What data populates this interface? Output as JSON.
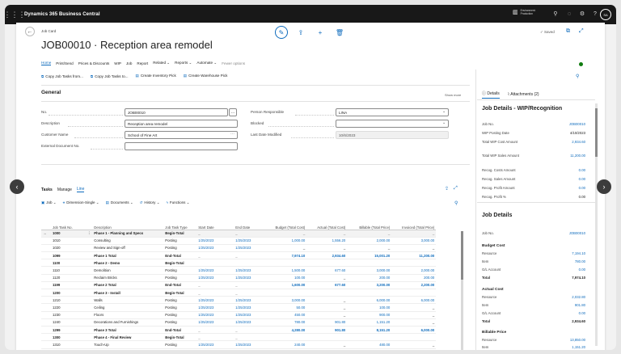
{
  "app": {
    "title": "Dynamics 365 Business Central",
    "env_line1": "Environment:",
    "env_line2": "Production",
    "avatar": "SA"
  },
  "page": {
    "breadcrumb": "Job Card",
    "title": "JOB00010 · Reception area remodel",
    "saved": "Saved"
  },
  "menu": [
    "Home",
    "Print/Send",
    "Prices & Discounts",
    "WIP",
    "Job",
    "Report",
    "Related",
    "Reports",
    "Automate",
    "Fewer options"
  ],
  "actions": [
    "Copy Job Tasks from...",
    "Copy Job Tasks to...",
    "Create Inventory Pick",
    "Create Warehouse Pick"
  ],
  "general": {
    "title": "General",
    "show_more": "Show more",
    "no_label": "No.",
    "no_value": "JOB00010",
    "desc_label": "Description",
    "desc_value": "Reception area remodel",
    "cust_label": "Customer Name",
    "cust_value": "School of Fine Art",
    "ext_label": "External Document No.",
    "ext_value": "",
    "person_label": "Person Responsible",
    "person_value": "LINA",
    "blocked_label": "Blocked",
    "blocked_value": "",
    "lastmod_label": "Last Date Modified",
    "lastmod_value": "10/6/2023"
  },
  "tasks": {
    "tabs": [
      "Tasks",
      "Manage",
      "Line"
    ],
    "actions": [
      "Job",
      "Dimension-Single",
      "Documents",
      "History",
      "Functions"
    ],
    "columns": [
      "Job Task No.",
      "Description",
      "Job Task Type",
      "Start Date",
      "End Date",
      "Budget (Total Cost)",
      "Actual (Total Cost)",
      "Billable (Total Price)",
      "Invoiced (Total Price)"
    ],
    "rows": [
      {
        "no": "1000",
        "desc": "Phase 1 - Planning and Specs",
        "type": "Begin-Total",
        "start": "_",
        "end": "_",
        "budget": "_",
        "actual": "_",
        "billable": "_",
        "invoiced": "_",
        "bold": true,
        "sel": true
      },
      {
        "no": "1010",
        "desc": "Consulting",
        "type": "Posting",
        "start": "1/25/2023",
        "end": "1/25/2023",
        "budget": "1,000.00",
        "actual": "1,556.20",
        "billable": "2,000.00",
        "invoiced": "3,000.00"
      },
      {
        "no": "1020",
        "desc": "Review and Sign-off",
        "type": "Posting",
        "start": "1/25/2023",
        "end": "1/25/2023",
        "budget": "_",
        "actual": "_",
        "billable": "_",
        "invoiced": "_"
      },
      {
        "no": "1099",
        "desc": "Phase 1 Total",
        "type": "End-Total",
        "start": "_",
        "end": "_",
        "budget": "7,974.10",
        "actual": "2,934.60",
        "billable": "15,001.20",
        "invoiced": "11,200.00",
        "bold": true
      },
      {
        "no": "1100",
        "desc": "Phase 2 - Demo",
        "type": "Begin-Total",
        "start": "",
        "end": "",
        "budget": "",
        "actual": "",
        "billable": "",
        "invoiced": "",
        "bold": true
      },
      {
        "no": "1110",
        "desc": "Demolition",
        "type": "Posting",
        "start": "1/25/2023",
        "end": "1/25/2023",
        "budget": "1,500.00",
        "actual": "677.60",
        "billable": "3,000.00",
        "invoiced": "2,000.00"
      },
      {
        "no": "1120",
        "desc": "Reclaim Bricks",
        "type": "Posting",
        "start": "1/25/2023",
        "end": "1/25/2023",
        "budget": "100.00",
        "actual": "_",
        "billable": "200.00",
        "invoiced": "200.00"
      },
      {
        "no": "1199",
        "desc": "Phase 2 Total",
        "type": "End-Total",
        "start": "_",
        "end": "_",
        "budget": "1,600.00",
        "actual": "677.60",
        "billable": "3,200.00",
        "invoiced": "2,200.00",
        "bold": true
      },
      {
        "no": "1200",
        "desc": "Phase 3 - Install",
        "type": "Begin-Total",
        "start": "_",
        "end": "_",
        "budget": "",
        "actual": "",
        "billable": "",
        "invoiced": "",
        "bold": true
      },
      {
        "no": "1210",
        "desc": "Walls",
        "type": "Posting",
        "start": "1/25/2023",
        "end": "1/25/2023",
        "budget": "3,000.00",
        "actual": "_",
        "billable": "6,000.00",
        "invoiced": "6,000.00"
      },
      {
        "no": "1220",
        "desc": "Ceiling",
        "type": "Posting",
        "start": "1/25/2023",
        "end": "1/25/2023",
        "budget": "50.00",
        "actual": "_",
        "billable": "100.00",
        "invoiced": "_"
      },
      {
        "no": "1230",
        "desc": "Floors",
        "type": "Posting",
        "start": "1/25/2023",
        "end": "1/25/2023",
        "budget": "450.00",
        "actual": "_",
        "billable": "900.00",
        "invoiced": "_"
      },
      {
        "no": "1240",
        "desc": "Decorations and Furnishings",
        "type": "Posting",
        "start": "1/25/2023",
        "end": "1/25/2023",
        "budget": "780.00",
        "actual": "901.80",
        "billable": "1,151.20",
        "invoiced": "_"
      },
      {
        "no": "1299",
        "desc": "Phase 3 Total",
        "type": "End-Total",
        "start": "_",
        "end": "_",
        "budget": "4,280.00",
        "actual": "901.80",
        "billable": "8,151.20",
        "invoiced": "6,000.00",
        "bold": true
      },
      {
        "no": "1300",
        "desc": "Phase 4 - Final Review",
        "type": "Begin-Total",
        "start": "_",
        "end": "_",
        "budget": "",
        "actual": "",
        "billable": "",
        "invoiced": "",
        "bold": true
      },
      {
        "no": "1310",
        "desc": "Touch-Up",
        "type": "Posting",
        "start": "1/25/2023",
        "end": "1/25/2023",
        "budget": "240.00",
        "actual": "_",
        "billable": "480.00",
        "invoiced": "_"
      }
    ]
  },
  "factbox": {
    "tab_details": "Details",
    "tab_attachments": "Attachments (2)",
    "wip_title": "Job Details - WIP/Recognition",
    "wip": [
      {
        "k": "Job No.",
        "v": "JOB00010",
        "link": true
      },
      {
        "k": "WIP Posting Date",
        "v": "4/10/2023"
      },
      {
        "k": "Total WIP Cost Amount",
        "v": "2,934.60",
        "link": true
      },
      {
        "k": "Total WIP Sales Amount",
        "v": "11,200.00",
        "link": true
      },
      {
        "k": "Recog. Costs Amount",
        "v": "0.00",
        "link": true
      },
      {
        "k": "Recog. Sales Amount",
        "v": "0.00",
        "link": true
      },
      {
        "k": "Recog. Profit Amount",
        "v": "0.00",
        "link": true
      },
      {
        "k": "Recog. Profit %",
        "v": "0.00"
      }
    ],
    "job_title": "Job Details",
    "job_no_label": "Job No.",
    "job_no_value": "JOB00010",
    "budget_head": "Budget Cost",
    "budget": [
      {
        "k": "Resource",
        "v": "7,194.10"
      },
      {
        "k": "Item",
        "v": "780.00"
      },
      {
        "k": "G/L Account",
        "v": "0.00"
      },
      {
        "k": "Total",
        "v": "7,974.10",
        "bold": true
      }
    ],
    "actual_head": "Actual Cost",
    "actual": [
      {
        "k": "Resource",
        "v": "2,032.80"
      },
      {
        "k": "Item",
        "v": "901.80"
      },
      {
        "k": "G/L Account",
        "v": "0.00"
      },
      {
        "k": "Total",
        "v": "2,934.60",
        "bold": true
      }
    ],
    "billable_head": "Billable Price",
    "billable": [
      {
        "k": "Resource",
        "v": "13,850.00"
      },
      {
        "k": "Item",
        "v": "1,151.20"
      }
    ]
  },
  "colors": {
    "accent": "#0f6cbd",
    "topbar": "#181818",
    "green": "#107c10"
  }
}
